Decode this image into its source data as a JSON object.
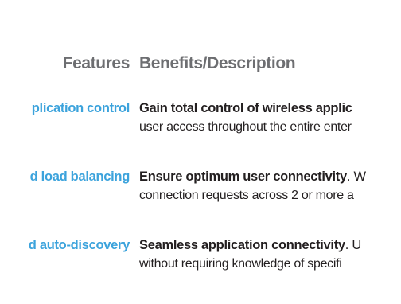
{
  "table": {
    "header": {
      "features": "Features",
      "description": "Benefits/Description"
    },
    "rows": [
      {
        "feature": "plication control",
        "lead_bold": "Gain total control of wireless applic",
        "lead_rest": "",
        "detail": "user access throughout the entire enter"
      },
      {
        "feature": "d load balancing",
        "lead_bold": "Ensure optimum user connectivity",
        "lead_rest": ". W",
        "detail": "connection requests across 2 or more a"
      },
      {
        "feature": "d auto-discovery",
        "lead_bold": "Seamless application connectivity",
        "lead_rest": ". U",
        "detail": "without requiring knowledge of specifi"
      }
    ]
  },
  "colors": {
    "header_text": "#6d6e71",
    "feature_text": "#3ca3dc",
    "body_text": "#231f20"
  }
}
